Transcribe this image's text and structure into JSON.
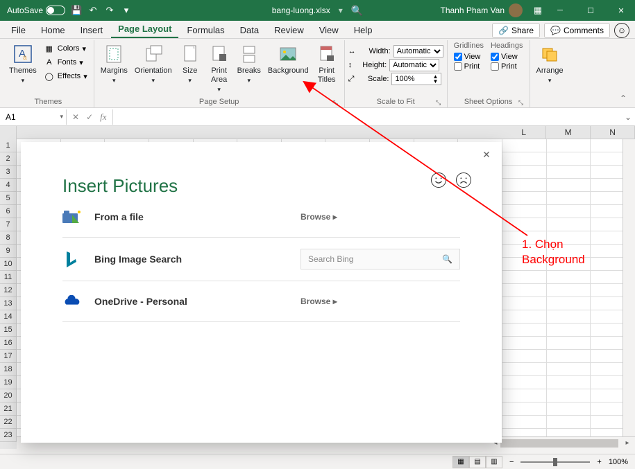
{
  "titlebar": {
    "autosave": "AutoSave",
    "filename": "bang-luong.xlsx",
    "user": "Thanh Pham Van"
  },
  "tabs": {
    "file": "File",
    "home": "Home",
    "insert": "Insert",
    "pagelayout": "Page Layout",
    "formulas": "Formulas",
    "data": "Data",
    "review": "Review",
    "view": "View",
    "help": "Help",
    "share": "Share",
    "comments": "Comments"
  },
  "ribbon": {
    "themes": {
      "themes": "Themes",
      "colors": "Colors",
      "fonts": "Fonts",
      "effects": "Effects",
      "group": "Themes"
    },
    "pagesetup": {
      "margins": "Margins",
      "orientation": "Orientation",
      "size": "Size",
      "printarea": "Print\nArea",
      "breaks": "Breaks",
      "background": "Background",
      "printtitles": "Print\nTitles",
      "group": "Page Setup"
    },
    "scale": {
      "width": "Width:",
      "height": "Height:",
      "scale": "Scale:",
      "auto": "Automatic",
      "pct": "100%",
      "group": "Scale to Fit"
    },
    "sheet": {
      "gridlines": "Gridlines",
      "headings": "Headings",
      "view": "View",
      "print": "Print",
      "group": "Sheet Options"
    },
    "arrange": {
      "arrange": "Arrange",
      "group": ""
    }
  },
  "fbar": {
    "name": "A1"
  },
  "cols": [
    "L",
    "M",
    "N"
  ],
  "dialog": {
    "title": "Insert Pictures",
    "fromfile": "From a file",
    "bing": "Bing Image Search",
    "onedrive": "OneDrive - Personal",
    "browse": "Browse",
    "searchPlaceholder": "Search Bing"
  },
  "annotation": "1. Chọn\nBackground",
  "status": {
    "zoom": "100%"
  }
}
